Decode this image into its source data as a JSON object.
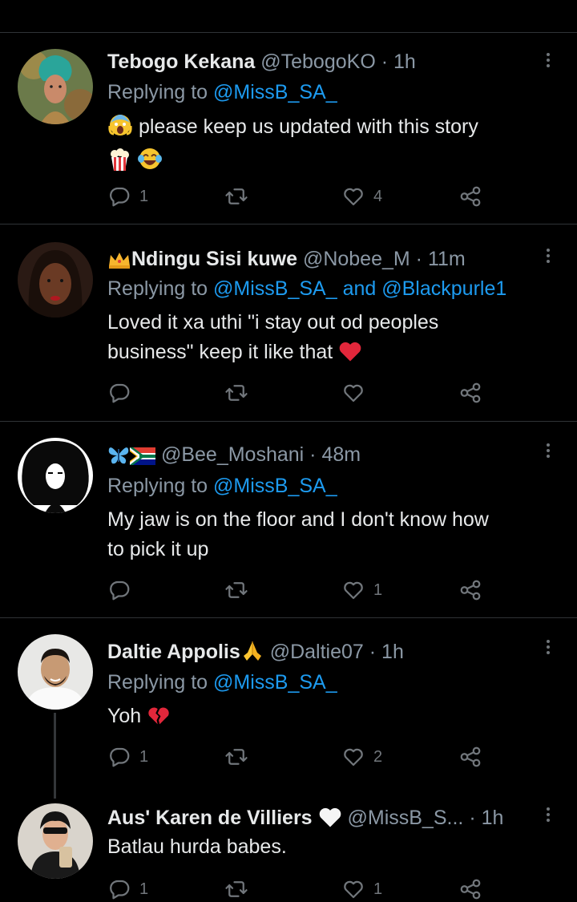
{
  "colors": {
    "background": "#000000",
    "text": "#e7e9ea",
    "muted": "#71767b",
    "link": "#1d9bf0",
    "divider": "#2f3336"
  },
  "tweets": [
    {
      "name": "Tebogo Kekana",
      "handle": "@TebogoKO",
      "time": "· 1h",
      "replying_prefix": "Replying to",
      "mentions": "@MissB_SA_",
      "mentions_and": "",
      "mentions2": "",
      "text1": "please keep us updated with this story",
      "text2": "",
      "emojis": [
        "face-screaming-icon",
        "popcorn-icon",
        "tears-of-joy-icon"
      ],
      "reply_count": "1",
      "retweet_count": "",
      "like_count": "4"
    },
    {
      "name": "Ndingu Sisi kuwe",
      "handle": "@Nobee_M",
      "time": "· 11m",
      "replying_prefix": "Replying to",
      "mentions": "@MissB_SA_",
      "mentions_and": "and",
      "mentions2": "@Blackpurle1",
      "text1": "Loved it xa uthi \"i stay out od peoples",
      "text2": "business\" keep it like that",
      "emojis": [
        "crown-icon",
        "red-heart-icon"
      ],
      "reply_count": "",
      "retweet_count": "",
      "like_count": ""
    },
    {
      "name": "",
      "handle": "@Bee_Moshani",
      "time": "· 48m",
      "replying_prefix": "Replying to",
      "mentions": "@MissB_SA_",
      "mentions_and": "",
      "mentions2": "",
      "text1": "My jaw is on the floor and I don't know how",
      "text2": "to pick it up",
      "emojis": [
        "butterfly-icon",
        "south-africa-flag-icon"
      ],
      "reply_count": "",
      "retweet_count": "",
      "like_count": "1"
    },
    {
      "name": "Daltie Appolis",
      "handle": "@Daltie07",
      "time": "· 1h",
      "replying_prefix": "Replying to",
      "mentions": "@MissB_SA_",
      "mentions_and": "",
      "mentions2": "",
      "text1": "Yoh",
      "text2": "",
      "emojis": [
        "folded-hands-icon",
        "broken-heart-icon"
      ],
      "reply_count": "1",
      "retweet_count": "",
      "like_count": "2"
    },
    {
      "name": "Aus' Karen de Villiers",
      "handle": "@MissB_S...",
      "time": "· 1h",
      "replying_prefix": "",
      "mentions": "",
      "mentions_and": "",
      "mentions2": "",
      "text1": "Batlau hurda babes.",
      "text2": "",
      "emojis": [
        "white-heart-icon"
      ],
      "reply_count": "1",
      "retweet_count": "",
      "like_count": "1"
    }
  ]
}
